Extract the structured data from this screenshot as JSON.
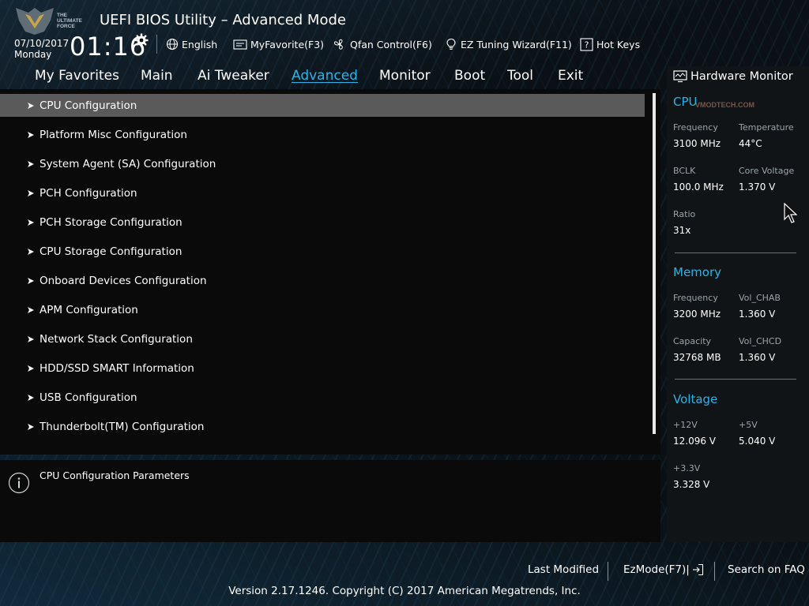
{
  "header": {
    "logo_lines": [
      "THE",
      "ULTIMATE",
      "FORCE"
    ],
    "title": "UEFI BIOS Utility – Advanced Mode",
    "date": "07/10/2017",
    "day": "Monday",
    "time": "01:16",
    "toolbar": [
      {
        "label": "English",
        "icon": "globe-icon"
      },
      {
        "label": "MyFavorite(F3)",
        "icon": "favorite-icon"
      },
      {
        "label": "Qfan Control(F6)",
        "icon": "fan-icon"
      },
      {
        "label": "EZ Tuning Wizard(F11)",
        "icon": "bulb-icon"
      },
      {
        "label": "Hot Keys",
        "icon": "question-icon"
      }
    ]
  },
  "tabs": [
    {
      "label": "My Favorites",
      "active": false
    },
    {
      "label": "Main",
      "active": false
    },
    {
      "label": "Ai Tweaker",
      "active": false
    },
    {
      "label": "Advanced",
      "active": true
    },
    {
      "label": "Monitor",
      "active": false
    },
    {
      "label": "Boot",
      "active": false
    },
    {
      "label": "Tool",
      "active": false
    },
    {
      "label": "Exit",
      "active": false
    }
  ],
  "menu_items": [
    {
      "label": "CPU Configuration",
      "selected": true
    },
    {
      "label": "Platform Misc Configuration",
      "selected": false
    },
    {
      "label": "System Agent (SA) Configuration",
      "selected": false
    },
    {
      "label": "PCH Configuration",
      "selected": false
    },
    {
      "label": "PCH Storage Configuration",
      "selected": false
    },
    {
      "label": "CPU Storage Configuration",
      "selected": false
    },
    {
      "label": "Onboard Devices Configuration",
      "selected": false
    },
    {
      "label": "APM Configuration",
      "selected": false
    },
    {
      "label": "Network Stack Configuration",
      "selected": false
    },
    {
      "label": "HDD/SSD SMART Information",
      "selected": false
    },
    {
      "label": "USB Configuration",
      "selected": false
    },
    {
      "label": "Thunderbolt(TM) Configuration",
      "selected": false
    }
  ],
  "description": "CPU Configuration Parameters",
  "hardware_monitor": {
    "title": "Hardware Monitor",
    "watermark": "VMODTECH.COM",
    "cpu": {
      "title": "CPU",
      "frequency_label": "Frequency",
      "frequency": "3100 MHz",
      "temperature_label": "Temperature",
      "temperature": "44°C",
      "bclk_label": "BCLK",
      "bclk": "100.0 MHz",
      "core_voltage_label": "Core Voltage",
      "core_voltage": "1.370 V",
      "ratio_label": "Ratio",
      "ratio": "31x"
    },
    "memory": {
      "title": "Memory",
      "frequency_label": "Frequency",
      "frequency": "3200 MHz",
      "vol_chab_label": "Vol_CHAB",
      "vol_chab": "1.360 V",
      "capacity_label": "Capacity",
      "capacity": "32768 MB",
      "vol_chcd_label": "Vol_CHCD",
      "vol_chcd": "1.360 V"
    },
    "voltage": {
      "title": "Voltage",
      "v12_label": "+12V",
      "v12": "12.096 V",
      "v5_label": "+5V",
      "v5": "5.040 V",
      "v33_label": "+3.3V",
      "v33": "3.328 V"
    }
  },
  "footer": {
    "last_modified": "Last Modified",
    "ezmode": "EzMode(F7)|",
    "search_faq": "Search on FAQ",
    "copyright": "Version 2.17.1246. Copyright (C) 2017 American Megatrends, Inc."
  },
  "colors": {
    "accent": "#28b4e6",
    "selected_row": "#5a5a5a",
    "panel": "#0a0a0a"
  }
}
